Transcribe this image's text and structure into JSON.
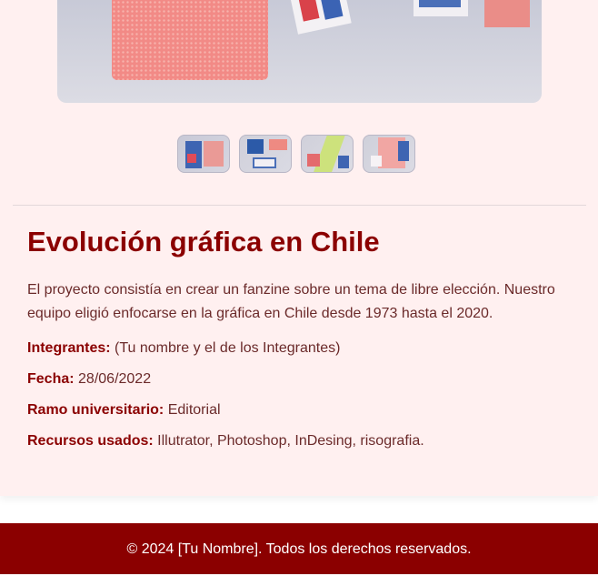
{
  "project": {
    "title": "Evolución gráfica en Chile",
    "description": "El proyecto consistía en crear un fanzine sobre un tema de libre elección. Nuestro equipo eligió enfocarse en la gráfica en Chile desde 1973 hasta el 2020.",
    "details": [
      {
        "label": "Integrantes:",
        "value": " (Tu nombre y el de los Integrantes)"
      },
      {
        "label": "Fecha:",
        "value": " 28/06/2022"
      },
      {
        "label": "Ramo universitario:",
        "value": " Editorial"
      },
      {
        "label": "Recursos usados:",
        "value": " Illutrator, Photoshop, InDesing, risografia."
      }
    ]
  },
  "gallery": {
    "thumbnail_count": 4
  },
  "footer": {
    "text": "© 2024 [Tu Nombre]. Todos los derechos reservados."
  },
  "colors": {
    "accent": "#8b0000",
    "card_background": "#fff0f0"
  }
}
